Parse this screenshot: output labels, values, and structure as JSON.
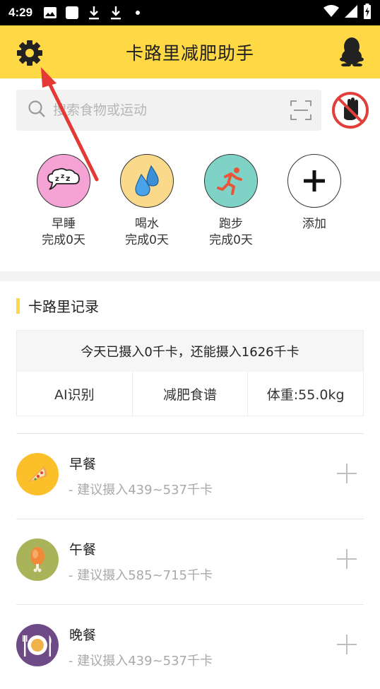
{
  "status_bar": {
    "time": "4:29",
    "icons": [
      "image-icon",
      "square-icon",
      "download-icon",
      "download-icon",
      "dot-icon"
    ],
    "right_icons": [
      "wifi-icon",
      "signal-icon",
      "battery-icon"
    ]
  },
  "header": {
    "title": "卡路里减肥助手",
    "left_icon": "gear-icon",
    "right_icon": "qq-penguin-icon",
    "background": "#fed845"
  },
  "search": {
    "placeholder": "搜索食物或运动",
    "scan_icon": "scan-icon",
    "noads_icon": "no-ads-hand-icon"
  },
  "habits": [
    {
      "name": "早睡",
      "days": "完成0天",
      "icon": "sleep-icon",
      "color": "#f5a3d4"
    },
    {
      "name": "喝水",
      "days": "完成0天",
      "icon": "water-drop-icon",
      "color": "#fbd98a"
    },
    {
      "name": "跑步",
      "days": "完成0天",
      "icon": "runner-icon",
      "color": "#7ed3c6"
    },
    {
      "name": "添加",
      "days": "",
      "icon": "plus-icon",
      "color": "#ffffff"
    }
  ],
  "calorie_section": {
    "title": "卡路里记录",
    "summary": "今天已摄入0千卡，还能摄入1626千卡",
    "actions": [
      "AI识别",
      "减肥食谱",
      "体重:55.0kg"
    ]
  },
  "meals": [
    {
      "name": "早餐",
      "hint": "- 建议摄入439~537千卡",
      "icon": "pizza-icon",
      "color": "#fbbf2a"
    },
    {
      "name": "午餐",
      "hint": "- 建议摄入585~715千卡",
      "icon": "chicken-leg-icon",
      "color": "#a9b35a"
    },
    {
      "name": "晚餐",
      "hint": "- 建议摄入439~537千卡",
      "icon": "plate-cutlery-icon",
      "color": "#6e4a86"
    }
  ],
  "colors": {
    "accent": "#fed845",
    "annotation_arrow": "#e53935"
  }
}
